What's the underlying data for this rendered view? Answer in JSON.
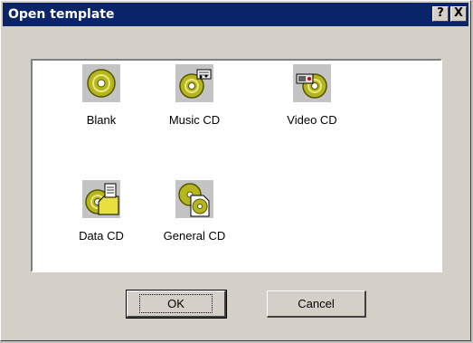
{
  "window": {
    "title": "Open template"
  },
  "titlebar": {
    "help_label": "?",
    "close_label": "X"
  },
  "templates": [
    {
      "label": "Blank",
      "icon": "cd-icon"
    },
    {
      "label": "Music CD",
      "icon": "music-cd-icon"
    },
    {
      "label": "Video CD",
      "icon": "video-cd-icon"
    },
    {
      "label": "Data CD",
      "icon": "data-cd-icon"
    },
    {
      "label": "General CD",
      "icon": "general-cd-icon"
    }
  ],
  "buttons": {
    "ok_label": "OK",
    "cancel_label": "Cancel"
  },
  "colors": {
    "titlebar": "#0a246a",
    "dialog": "#d4d0c8",
    "disc": "#b8b800",
    "icon_bg": "#c4c4c4"
  }
}
